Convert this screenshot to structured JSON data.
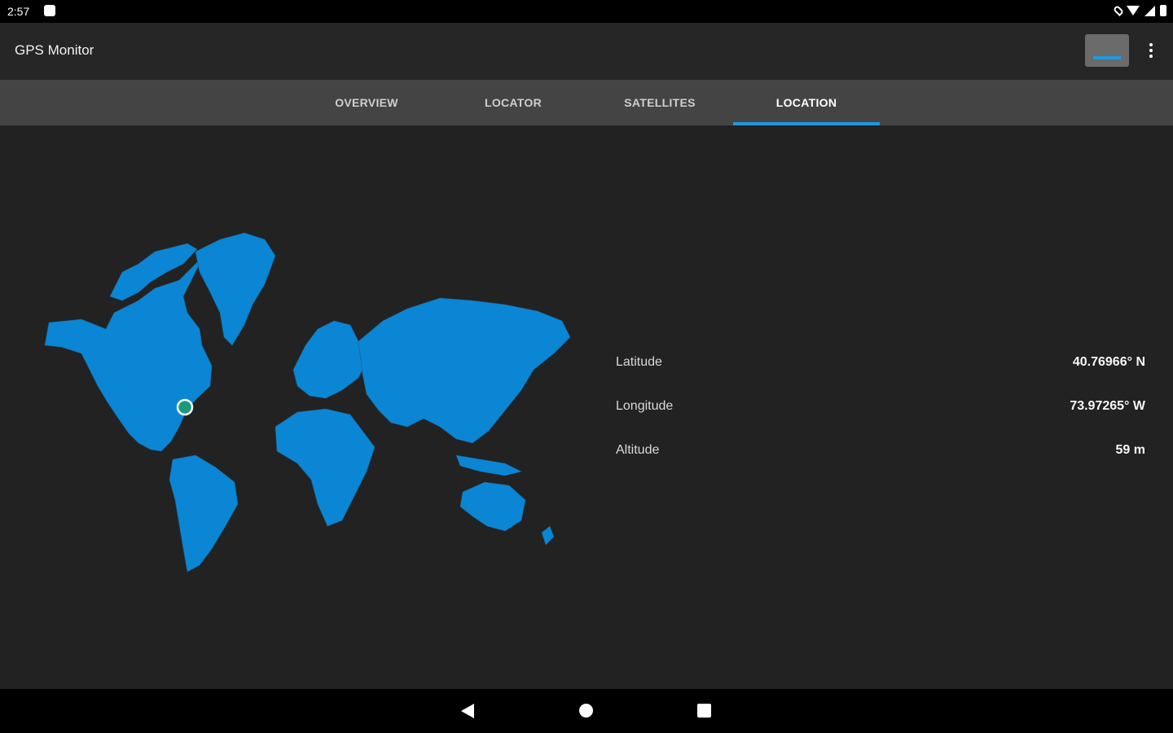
{
  "status_bar": {
    "time": "2:57"
  },
  "app_bar": {
    "title": "GPS Monitor"
  },
  "tabs": [
    {
      "label": "OVERVIEW",
      "active": false
    },
    {
      "label": "LOCATOR",
      "active": false
    },
    {
      "label": "SATELLITES",
      "active": false
    },
    {
      "label": "LOCATION",
      "active": true
    }
  ],
  "location": {
    "latitude_label": "Latitude",
    "latitude_value": "40.76966° N",
    "longitude_label": "Longitude",
    "longitude_value": "73.97265° W",
    "altitude_label": "Altitude",
    "altitude_value": "59 m"
  },
  "colors": {
    "accent": "#2196e0",
    "map_land": "#0a86d4",
    "marker": "#1a9a7a"
  }
}
